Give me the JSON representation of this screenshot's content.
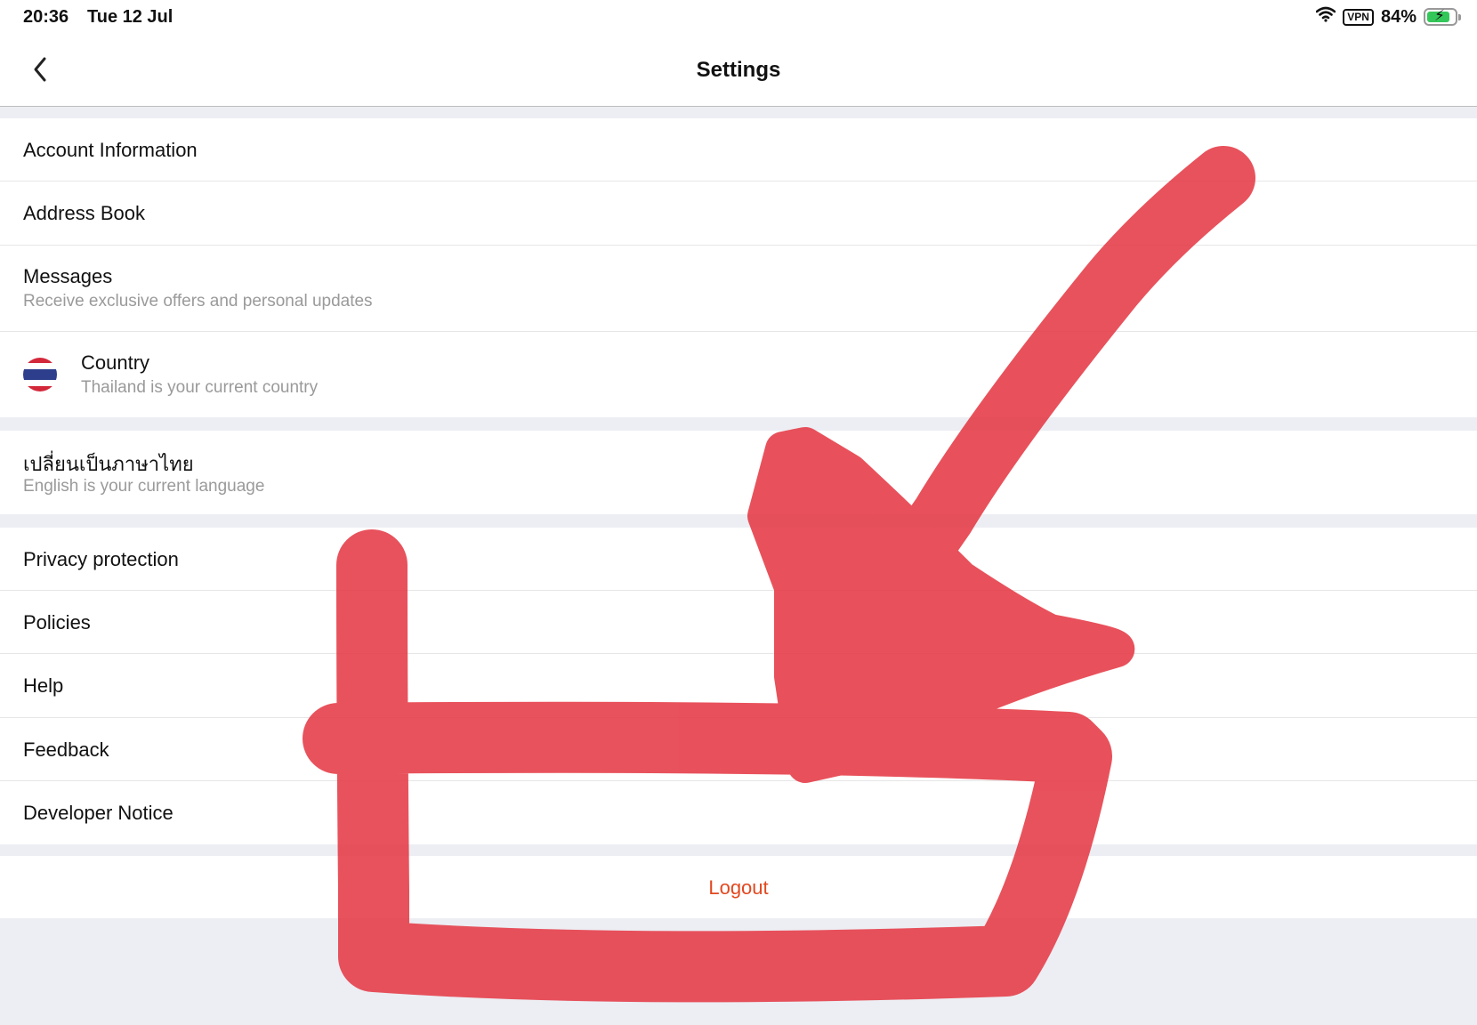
{
  "status_bar": {
    "time": "20:36",
    "date": "Tue 12 Jul",
    "vpn": "VPN",
    "battery": "84%",
    "battery_level": 0.84
  },
  "nav": {
    "title": "Settings",
    "back_icon": "chevron-left-icon"
  },
  "group1": {
    "account": "Account Information",
    "address": "Address Book",
    "messages_title": "Messages",
    "messages_sub": "Receive exclusive offers and personal updates",
    "country_title": "Country",
    "country_sub": "Thailand is your current country",
    "country_icon": "thailand-flag-icon"
  },
  "group2": {
    "language_title": "เปลี่ยนเป็นภาษาไทย",
    "language_sub": "English is your current language"
  },
  "group3": {
    "privacy": "Privacy protection",
    "policies": "Policies",
    "help": "Help",
    "feedback": "Feedback",
    "developer": "Developer Notice"
  },
  "logout": {
    "label": "Logout",
    "color": "#e2481f"
  },
  "annotation": {
    "color": "#e53a45",
    "shapes": [
      "check-mark-scribble",
      "box-scribble"
    ]
  }
}
